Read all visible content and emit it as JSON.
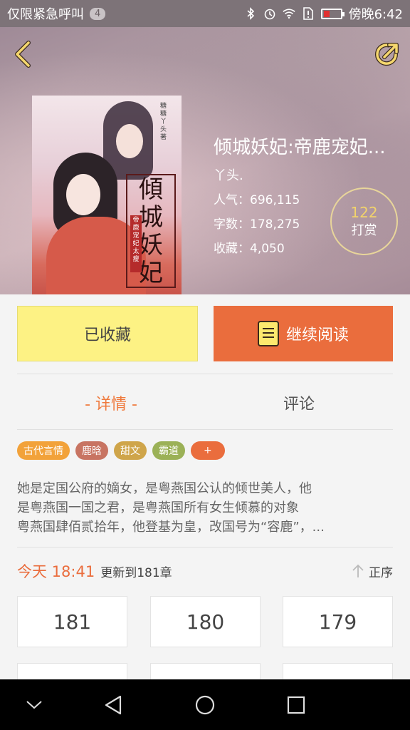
{
  "status_bar": {
    "carrier_text": "仅限紧急呼叫",
    "notification_count": "4",
    "time": "傍晚6:42"
  },
  "header": {
    "book_title": "倾城妖妃:帝鹿宠妃...",
    "author": "丫头.",
    "popularity": "人气：696,115",
    "word_count": "字数：178,275",
    "favorites": "收藏：4,050",
    "tip_count": "122",
    "tip_label": "打赏"
  },
  "cover": {
    "small_author": "糖糖丫头　著",
    "title_chars": [
      "傾",
      "城",
      "妖",
      "妃"
    ],
    "seal_text": "帝鹿宠妃太瘦"
  },
  "actions": {
    "collected_label": "已收藏",
    "continue_label": "继续阅读"
  },
  "tabs": {
    "detail": "- 详情 -",
    "comment": "评论"
  },
  "tags": [
    {
      "label": "古代言情",
      "color": "#f2a23a"
    },
    {
      "label": "鹿晗",
      "color": "#c87462"
    },
    {
      "label": "甜文",
      "color": "#cfa54a"
    },
    {
      "label": "霸道",
      "color": "#9bb157"
    },
    {
      "label": "+",
      "color": "#ea6d3d"
    }
  ],
  "intro": {
    "line1": "她是定国公府的嫡女，是粤燕国公认的倾世美人，他",
    "line2": "是粤燕国一国之君，是粤燕国所有女生倾慕的对象",
    "line3": "粤燕国肆佰贰拾年，他登基为皇，改国号为“容鹿”，..."
  },
  "update": {
    "time": "今天 18:41",
    "text": "更新到181章",
    "sort_label": "正序"
  },
  "chapters": [
    "181",
    "180",
    "179",
    "",
    "",
    ""
  ],
  "colors": {
    "accent": "#ea6d3d",
    "collected_bg": "#fdf284",
    "tip_gold": "#f2d36b"
  },
  "icons": {
    "back": "chevron-left-icon",
    "share": "share-icon",
    "book": "book-icon",
    "sort": "arrow-up-icon",
    "nav_down": "chevron-down-icon",
    "nav_back": "triangle-back-icon",
    "nav_home": "circle-home-icon",
    "nav_recent": "square-recent-icon"
  }
}
